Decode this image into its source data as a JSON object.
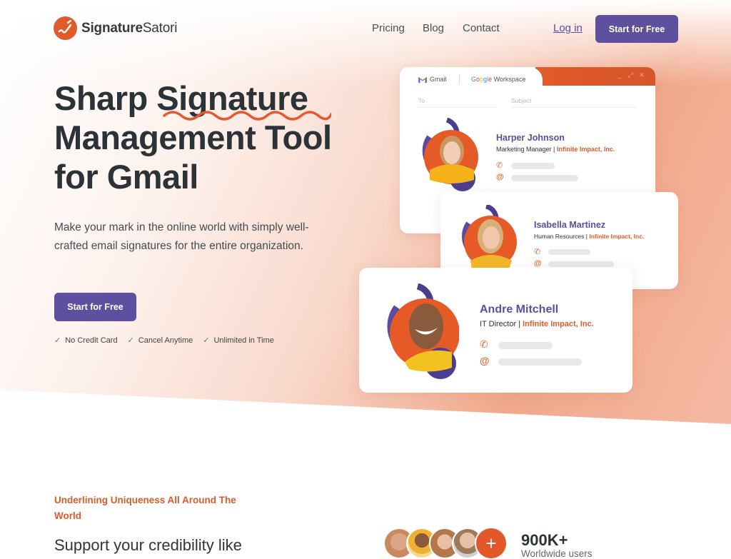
{
  "brand": {
    "name_bold": "Signature",
    "name_light": "Satori",
    "accent": "#e05a2b",
    "primary": "#5e4f9f"
  },
  "nav": {
    "items": [
      {
        "label": "Pricing"
      },
      {
        "label": "Blog"
      },
      {
        "label": "Contact"
      }
    ],
    "login": "Log in",
    "cta": "Start for Free"
  },
  "hero": {
    "title_line1_a": "Sharp ",
    "title_line1_b": "Signature",
    "title_line2": "Management Tool",
    "title_line3": "for Gmail",
    "subtitle": "Make your mark in the online world with simply well-crafted email signatures for the entire organization.",
    "cta": "Start for Free",
    "checks": [
      "No Credit Card",
      "Cancel Anytime",
      "Unlimited in Time"
    ]
  },
  "composer": {
    "gmail_label": "Gmail",
    "workspace_label": "Google Workspace",
    "to_placeholder": "To",
    "subject_placeholder": "Subject",
    "window_controls": "_ ⤢ ✕"
  },
  "signatures": [
    {
      "name": "Harper Johnson",
      "role": "Marketing Manager",
      "company": "Infinite Impact, Inc."
    },
    {
      "name": "Isabella Martinez",
      "role": "Human Resources",
      "company": "Infinite Impact, Inc."
    },
    {
      "name": "Andre Mitchell",
      "role": "IT Director",
      "company": "Infinite Impact, Inc."
    }
  ],
  "section2": {
    "eyebrow": "Underlining Uniqueness All Around The World",
    "heading": "Support your credibility like"
  },
  "stats": {
    "value": "900K+",
    "label": "Worldwide users",
    "plus": "+"
  },
  "icons": {
    "phone": "✆",
    "at": "@",
    "check": "✓"
  }
}
